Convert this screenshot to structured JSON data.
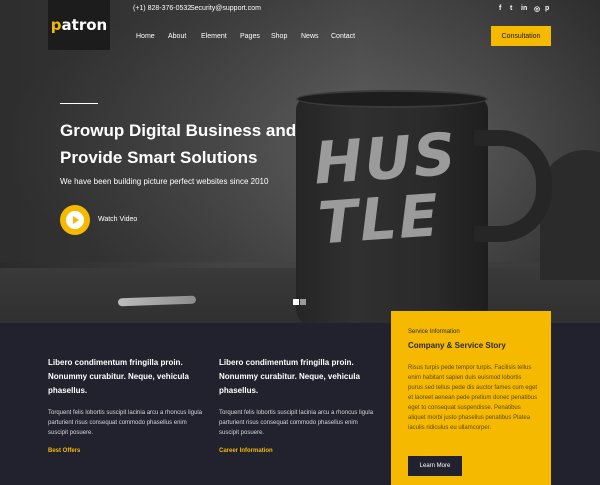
{
  "header": {
    "logo": "patron",
    "phone": "(+1) 828-376-0532",
    "email": "Security@support.com",
    "social_icons": [
      "facebook-icon",
      "twitter-icon",
      "linkedin-icon",
      "dribbble-icon",
      "pinterest-icon"
    ],
    "social_glyphs": [
      "f",
      "t",
      "in",
      "◎",
      "p"
    ],
    "nav": [
      "Home",
      "About",
      "Element",
      "Pages",
      "Shop",
      "News",
      "Contact"
    ],
    "cta": "Consultation"
  },
  "hero": {
    "title": "Growup Digital Business and Provide Smart Solutions",
    "subtitle": "We have been building picture perfect websites since 2010",
    "video_label": "Watch Video",
    "mug_text": "HUS TLE"
  },
  "features": [
    {
      "title": "Libero condimentum fringilla proin. Nonummy curabitur. Neque, vehicula phasellus.",
      "text": "Torquent felis lobortis suscipit lacinia arcu a rhoncus ligula parturient risus consequat commodo phasellus enim suscipit posuere.",
      "link": "Best Offers"
    },
    {
      "title": "Libero condimentum fringilla proin. Nonummy curabitur. Neque, vehicula phasellus.",
      "text": "Torquent felis lobortis suscipit lacinia arcu a rhoncus ligula parturient risus consequat commodo phasellus enim suscipit posuere.",
      "link": "Career Information"
    }
  ],
  "service": {
    "label": "Service Information",
    "title": "Company & Service Story",
    "text": "Risus turpis pede tempor turpis. Facilisis tellus enim habitant sapien duis euismod lobortis purus sed tellus pede dis auctor fames cum eget et laoreet aenean pede pretium donec penatibus eget to consequat suspendisse. Penatibus aliquet morbi justo phasellus penatibus Platea iaculis ridiculus eu ullamcorper.",
    "button": "Learn More"
  },
  "colors": {
    "accent": "#f5b900",
    "dark": "#22222e"
  }
}
